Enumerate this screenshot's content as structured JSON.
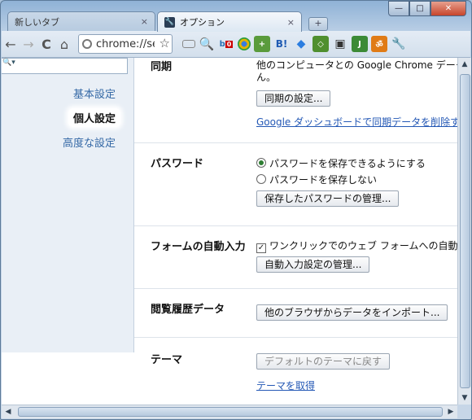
{
  "tabs": [
    {
      "label": "新しいタブ",
      "close": "×"
    },
    {
      "label": "オプション",
      "close": "×"
    }
  ],
  "new_tab": "+",
  "window_controls": {
    "minimize": "—",
    "maximize": "□",
    "close": "✕"
  },
  "toolbar": {
    "back": "←",
    "forward": "→",
    "reload": "C",
    "home": "⌂",
    "omnibox_text": "chrome://settings",
    "star": "☆",
    "extensions": [
      "page-action",
      "search-ext",
      "badge-ext",
      "chrome-ext",
      "green-ext",
      "bookmarks-ext",
      "dropbox-ext",
      "evernote-ext",
      "camera-ext",
      "translate-ext",
      "readlater-ext",
      "wrench"
    ]
  },
  "sidebar": {
    "search_placeholder": "🔍▾",
    "items": [
      {
        "label": "基本設定"
      },
      {
        "label": "個人設定"
      },
      {
        "label": "高度な設定"
      }
    ]
  },
  "sections": {
    "sync": {
      "title": "同期",
      "desc": "他のコンピュータとの Google Chrome データの同",
      "desc2": "ん。",
      "button": "同期の設定...",
      "link": "Google ダッシュボードで同期データを削除する"
    },
    "password": {
      "title": "パスワード",
      "option_save": "パスワードを保存できるようにする",
      "option_nosave": "パスワードを保存しない",
      "button": "保存したパスワードの管理..."
    },
    "autofill": {
      "title": "フォームの自動入力",
      "checkbox": "ワンクリックでのウェブ フォームへの自動入力を",
      "button": "自動入力設定の管理..."
    },
    "browsing": {
      "title": "閲覧履歴データ",
      "button": "他のブラウザからデータをインポート..."
    },
    "theme": {
      "title": "テーマ",
      "button": "デフォルトのテーマに戻す",
      "link": "テーマを取得"
    }
  }
}
